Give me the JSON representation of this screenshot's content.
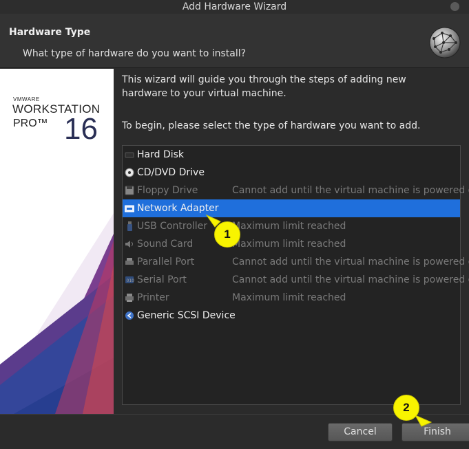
{
  "window": {
    "title": "Add Hardware Wizard"
  },
  "header": {
    "title": "Hardware Type",
    "subtitle": "What type of hardware do you want to install?"
  },
  "brand": {
    "vendor": "VMWARE",
    "product": "WORKSTATION",
    "edition": "PRO™",
    "version": "16"
  },
  "body": {
    "intro": "This wizard will guide you through the steps of adding new hardware to your virtual machine.",
    "instruction": "To begin, please select the type of hardware you want to add."
  },
  "hardware_list": [
    {
      "name": "Hard Disk",
      "status": "",
      "enabled": true,
      "selected": false,
      "icon": "hard-disk-icon"
    },
    {
      "name": "CD/DVD Drive",
      "status": "",
      "enabled": true,
      "selected": false,
      "icon": "cd-dvd-icon"
    },
    {
      "name": "Floppy Drive",
      "status": "Cannot add until the virtual machine is powered off",
      "enabled": false,
      "selected": false,
      "icon": "floppy-icon"
    },
    {
      "name": "Network Adapter",
      "status": "",
      "enabled": true,
      "selected": true,
      "icon": "network-adapter-icon"
    },
    {
      "name": "USB Controller",
      "status": "Maximum limit reached",
      "enabled": false,
      "selected": false,
      "icon": "usb-icon"
    },
    {
      "name": "Sound Card",
      "status": "Maximum limit reached",
      "enabled": false,
      "selected": false,
      "icon": "sound-card-icon"
    },
    {
      "name": "Parallel Port",
      "status": "Cannot add until the virtual machine is powered off",
      "enabled": false,
      "selected": false,
      "icon": "parallel-port-icon"
    },
    {
      "name": "Serial Port",
      "status": "Cannot add until the virtual machine is powered off",
      "enabled": false,
      "selected": false,
      "icon": "serial-port-icon"
    },
    {
      "name": "Printer",
      "status": "Maximum limit reached",
      "enabled": false,
      "selected": false,
      "icon": "printer-icon"
    },
    {
      "name": "Generic SCSI Device",
      "status": "",
      "enabled": true,
      "selected": false,
      "icon": "scsi-device-icon"
    }
  ],
  "buttons": {
    "cancel": "Cancel",
    "finish": "Finish"
  },
  "callouts": {
    "one": "1",
    "two": "2"
  },
  "colors": {
    "selection": "#1f6fdc",
    "callout": "#f8f400"
  }
}
